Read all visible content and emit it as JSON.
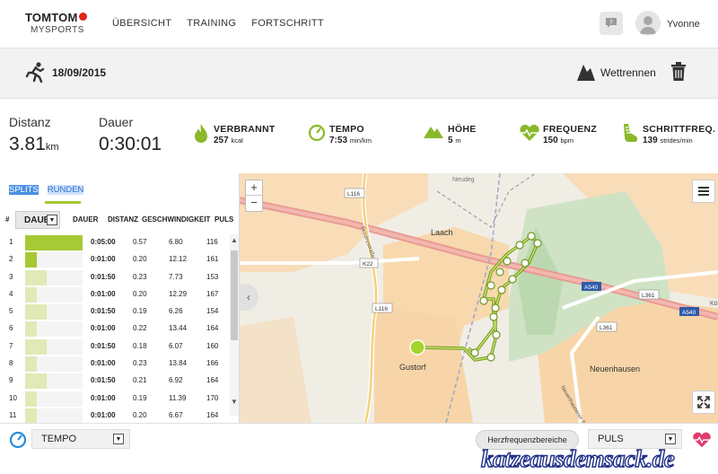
{
  "header": {
    "brand": "TOMTOM",
    "subbrand": "MYSPORTS",
    "nav": [
      "ÜBERSICHT",
      "TRAINING",
      "FORTSCHRITT"
    ],
    "username": "Yvonne"
  },
  "activity": {
    "date": "18/09/2015",
    "race_label": "Wettrennen"
  },
  "stats": {
    "distance_label": "Distanz",
    "distance_value": "3.81",
    "distance_unit": "km",
    "duration_label": "Dauer",
    "duration_value": "0:30:01",
    "burned_label": "VERBRANNT",
    "burned_value": "257",
    "burned_unit": "kcal",
    "tempo_label": "TEMPO",
    "tempo_value": "7:53",
    "tempo_unit": "min/km",
    "height_label": "HÖHE",
    "height_value": "5",
    "height_unit": "m",
    "freq_label": "FREQUENZ",
    "freq_value": "150",
    "freq_unit": "bpm",
    "step_label": "SCHRITTFREQ.",
    "step_value": "139",
    "step_unit": "strides/min"
  },
  "laps": {
    "tab_splits": "SPLITS",
    "tab_runden": "RUNDEN",
    "headers": {
      "num": "#",
      "sort": "DAUE",
      "dauer": "DAUER",
      "distanz": "DISTANZ",
      "speed": "GESCHWINDIGKEIT",
      "puls": "PULS"
    },
    "rows": [
      {
        "n": "1",
        "dauer": "0:05:00",
        "distanz": "0.57",
        "speed": "6.80",
        "puls": "116",
        "level": 1.0
      },
      {
        "n": "2",
        "dauer": "0:01:00",
        "distanz": "0.20",
        "speed": "12.12",
        "puls": "161",
        "level": 0.2
      },
      {
        "n": "3",
        "dauer": "0:01:50",
        "distanz": "0.23",
        "speed": "7.73",
        "puls": "153",
        "level": 0.37
      },
      {
        "n": "4",
        "dauer": "0:01:00",
        "distanz": "0.20",
        "speed": "12.29",
        "puls": "167",
        "level": 0.2
      },
      {
        "n": "5",
        "dauer": "0:01:50",
        "distanz": "0.19",
        "speed": "6.26",
        "puls": "154",
        "level": 0.37
      },
      {
        "n": "6",
        "dauer": "0:01:00",
        "distanz": "0.22",
        "speed": "13.44",
        "puls": "164",
        "level": 0.2
      },
      {
        "n": "7",
        "dauer": "0:01:50",
        "distanz": "0.18",
        "speed": "6.07",
        "puls": "160",
        "level": 0.37
      },
      {
        "n": "8",
        "dauer": "0:01:00",
        "distanz": "0.23",
        "speed": "13.84",
        "puls": "166",
        "level": 0.2
      },
      {
        "n": "9",
        "dauer": "0:01:50",
        "distanz": "0.21",
        "speed": "6.92",
        "puls": "164",
        "level": 0.37
      },
      {
        "n": "10",
        "dauer": "0:01:00",
        "distanz": "0.19",
        "speed": "11.39",
        "puls": "170",
        "level": 0.2
      },
      {
        "n": "11",
        "dauer": "0:01:00",
        "distanz": "0.20",
        "speed": "6.67",
        "puls": "164",
        "level": 0.2
      }
    ]
  },
  "map": {
    "labels": {
      "neuenhausen": "Neuenhausen",
      "gustorf": "Gustorf",
      "laach": "Laach",
      "l116a": "L116",
      "l116b": "L116",
      "k22": "K22",
      "a540a": "A540",
      "a540b": "A540",
      "l361a": "L361",
      "l361b": "L361",
      "neudeg": "Neudeg",
      "ko": "Kö",
      "prov": "Provinzstraße",
      "neuen_str": "Neuenhausener Straße"
    },
    "zoom_in": "+",
    "zoom_out": "−"
  },
  "bottom": {
    "left_select": "TEMPO",
    "hf_button": "Herzfrequenzbereiche",
    "right_select": "PULS",
    "watermark": "katzeausdemsack.de"
  },
  "colors": {
    "accent_green": "#a6c935",
    "route": "#8ab82a",
    "heart": "#e23d6d"
  }
}
